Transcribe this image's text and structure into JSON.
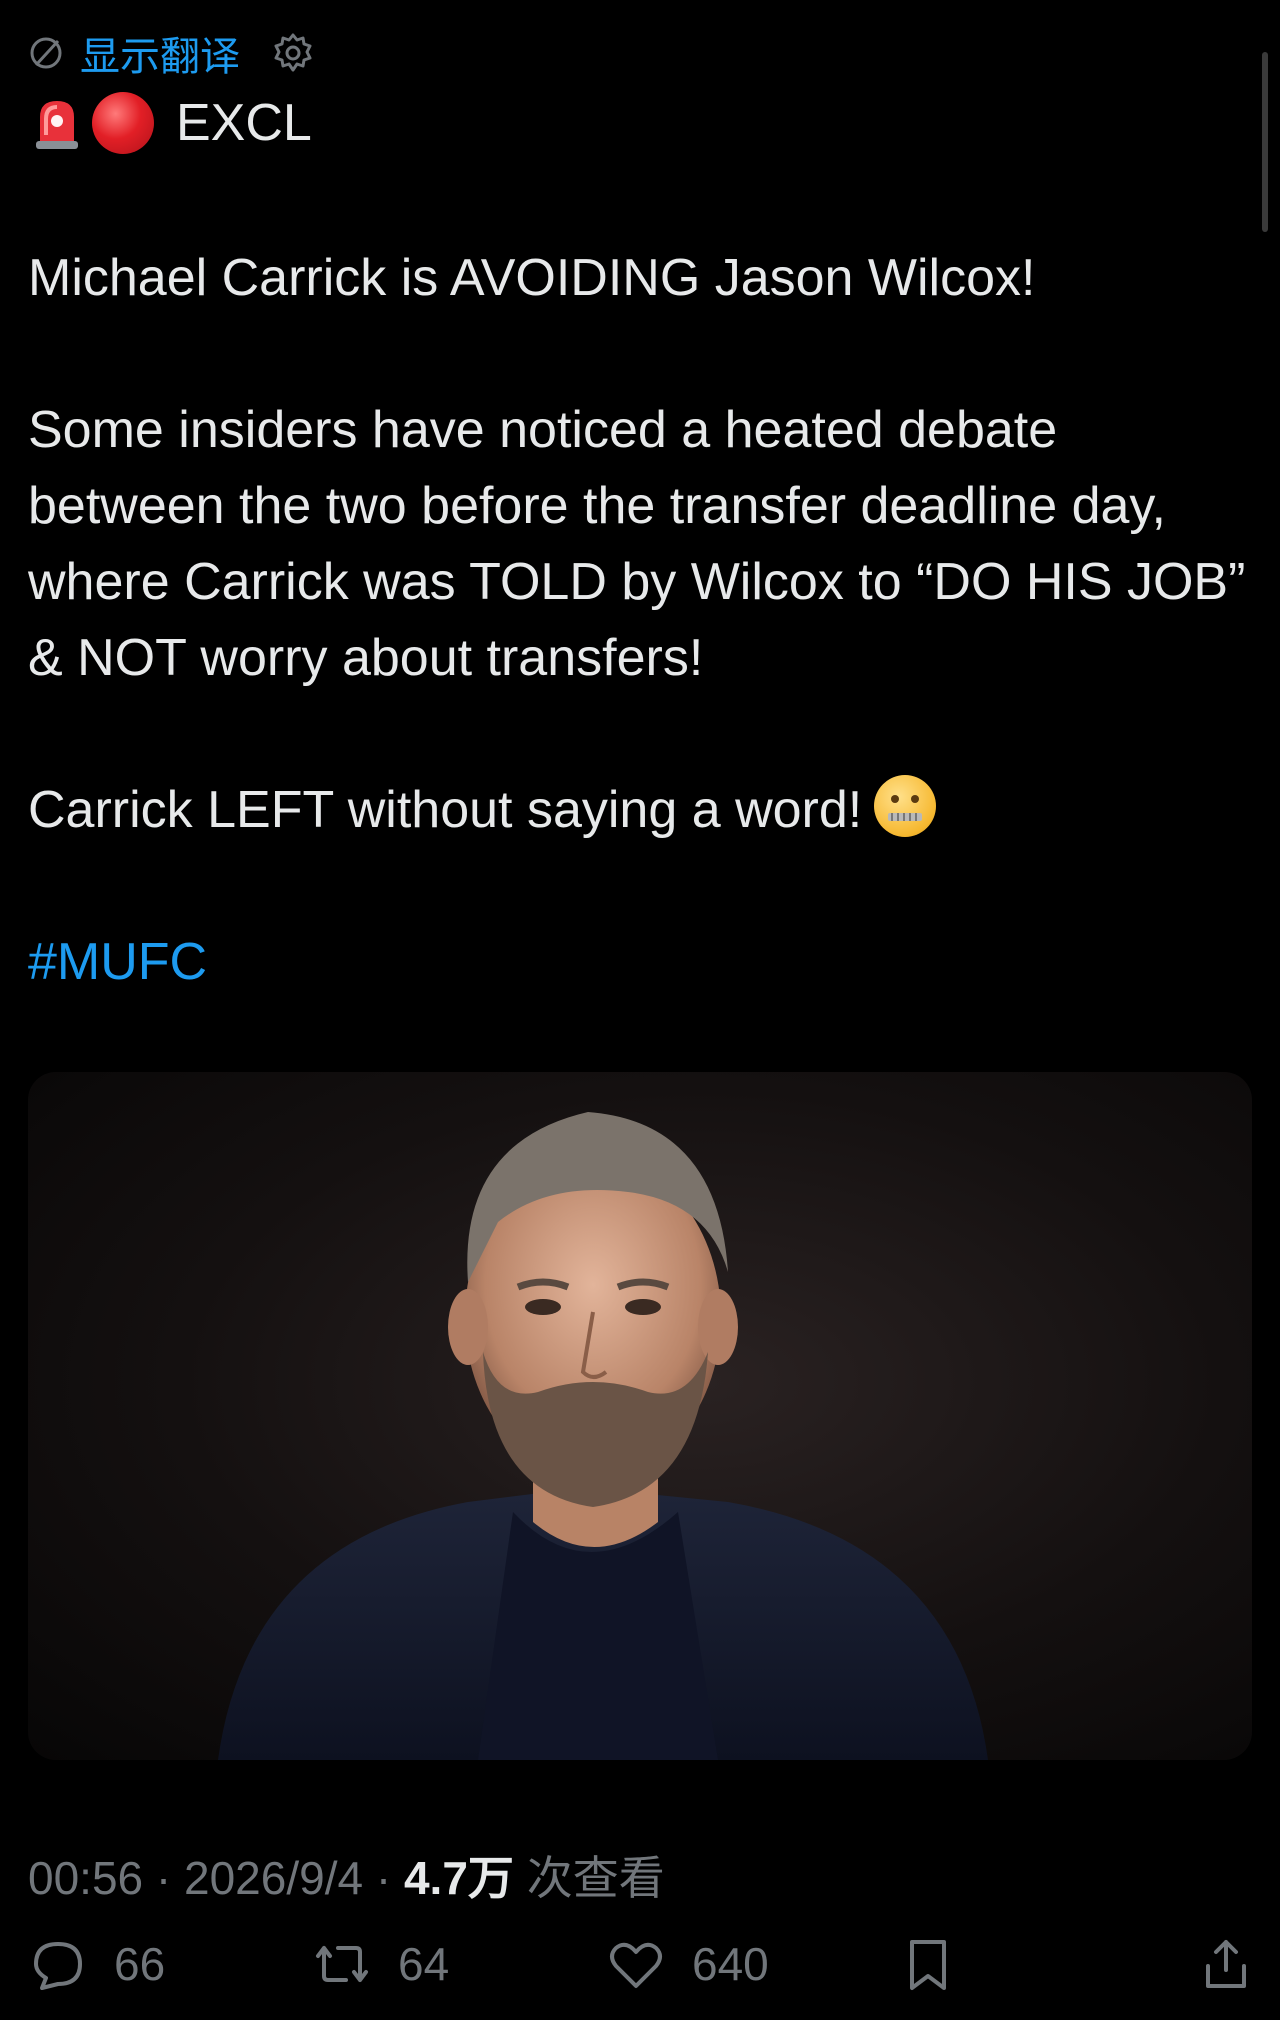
{
  "translate": {
    "label": "显示翻译"
  },
  "headline": {
    "text": "EXCL"
  },
  "tweet": {
    "p1": "Michael Carrick is AVOIDING Jason Wilcox!",
    "p2": "Some insiders have noticed a heated debate between the two before the transfer deadline day, where Carrick was TOLD by Wilcox to “DO HIS JOB” & NOT worry about transfers!",
    "p3": "Carrick LEFT without saying a word!",
    "hashtag": "#MUFC"
  },
  "meta": {
    "time": "00:56",
    "sep": " · ",
    "date": "2026/9/4",
    "views": "4.7万",
    "views_label": "次查看"
  },
  "actions": {
    "replies": "66",
    "reposts": "64",
    "likes": "640"
  },
  "colors": {
    "background": "#000000",
    "text": "#e7e9ea",
    "muted": "#71767b",
    "accent": "#1d9bf0"
  }
}
